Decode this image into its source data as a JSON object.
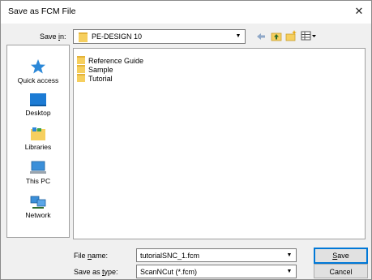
{
  "window": {
    "title": "Save as FCM File",
    "close_glyph": "✕"
  },
  "save_in": {
    "label": "Save in:",
    "value": "PE-DESIGN 10",
    "toolbar_icons": [
      "back-arrow-icon",
      "up-folder-icon",
      "new-folder-icon",
      "view-menu-icon"
    ]
  },
  "places": [
    {
      "label": "Quick access",
      "icon": "star-icon"
    },
    {
      "label": "Desktop",
      "icon": "desktop-icon"
    },
    {
      "label": "Libraries",
      "icon": "libraries-icon"
    },
    {
      "label": "This PC",
      "icon": "computer-icon"
    },
    {
      "label": "Network",
      "icon": "network-icon"
    }
  ],
  "files": [
    {
      "name": "Reference Guide"
    },
    {
      "name": "Sample"
    },
    {
      "name": "Tutorial"
    }
  ],
  "file_name": {
    "label": "File name:",
    "value": "tutorialSNC_1.fcm"
  },
  "save_as_type": {
    "label": "Save as type:",
    "value": "ScanNCut (*.fcm)"
  },
  "buttons": {
    "save": "Save",
    "cancel": "Cancel"
  },
  "colors": {
    "accent": "#0078d7",
    "folder": "#f6cf5e"
  }
}
